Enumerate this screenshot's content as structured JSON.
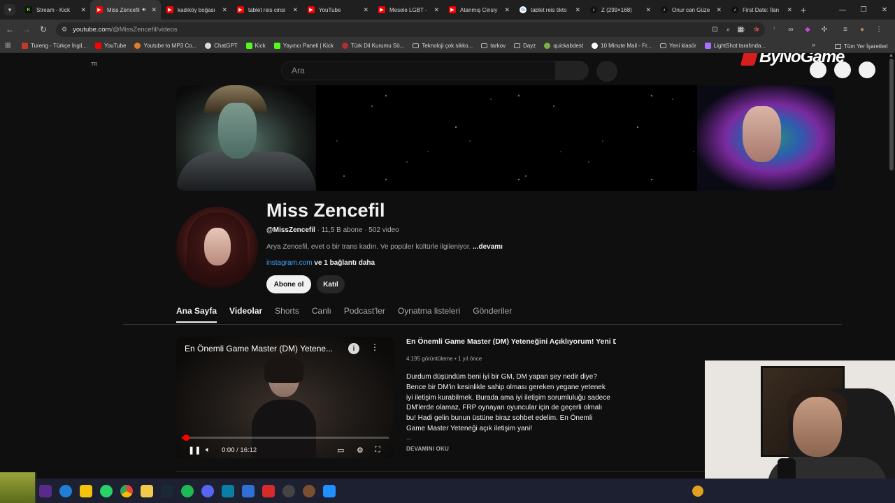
{
  "browser": {
    "tabs": [
      {
        "label": "Stream - Kick",
        "icon": "kick-icon",
        "kind": "kick",
        "active": false
      },
      {
        "label": "Miss Zencefil",
        "icon": "youtube-icon",
        "kind": "yt",
        "active": true
      },
      {
        "label": "kadıköy boğası",
        "icon": "youtube-icon",
        "kind": "yt",
        "active": false
      },
      {
        "label": "tablet reis cinsi",
        "icon": "youtube-icon",
        "kind": "yt",
        "active": false
      },
      {
        "label": "YouTube",
        "icon": "youtube-icon",
        "kind": "yt",
        "active": false
      },
      {
        "label": "Mesele LGBT -",
        "icon": "youtube-icon",
        "kind": "yt",
        "active": false
      },
      {
        "label": "Atanmış Cinsiy",
        "icon": "youtube-icon",
        "kind": "yt",
        "active": false
      },
      {
        "label": "tablet reis tikto",
        "icon": "google-icon",
        "kind": "g",
        "active": false
      },
      {
        "label": "Z (299×168)",
        "icon": "tiktok-icon",
        "kind": "tk",
        "active": false
      },
      {
        "label": "Onur can Güze",
        "icon": "tiktok-icon",
        "kind": "tk",
        "active": false
      },
      {
        "label": "First Date: İlan",
        "icon": "tiktok-icon",
        "kind": "tk",
        "active": false
      }
    ],
    "url_domain": "youtube.com",
    "url_path": "/@MissZencefil/videos",
    "bookmarks": [
      {
        "label": "Tureng - Türkçe İngil...",
        "icon": "tureng-icon"
      },
      {
        "label": "YouTube",
        "icon": "youtube-icon"
      },
      {
        "label": "Youtube to MP3 Co...",
        "icon": "converter-icon"
      },
      {
        "label": "ChatGPT",
        "icon": "chatgpt-icon"
      },
      {
        "label": "Kick",
        "icon": "kick-icon"
      },
      {
        "label": "Yayıncı Paneli | Kick",
        "icon": "kick-icon"
      },
      {
        "label": "Türk Dil Kurumu Sö...",
        "icon": "tdk-icon"
      },
      {
        "label": "Teknoloji çok sikko...",
        "icon": "folder-icon"
      },
      {
        "label": "tarkov",
        "icon": "folder-icon"
      },
      {
        "label": "Dayz",
        "icon": "folder-icon"
      },
      {
        "label": "quickabdest",
        "icon": "frog-icon"
      },
      {
        "label": "10 Minute Mail - Fr...",
        "icon": "mail-icon"
      },
      {
        "label": "Yeni klasör",
        "icon": "folder-icon"
      },
      {
        "label": "LightShot tarafında...",
        "icon": "lightshot-icon"
      }
    ],
    "bookmarks_all": "Tüm Yer İşaretleri"
  },
  "youtube": {
    "locale": "TR",
    "search_placeholder": "Ara",
    "overlay_logo": "ByNoGame",
    "channel": {
      "name": "Miss Zencefil",
      "handle": "@MissZencefil",
      "stats": " · 11,5 B abone · 502 video",
      "description": "Arya Zencefil, evet o bir trans kadın. Ve popüler kültürle ilgileniyor. ",
      "description_more": "...devamı",
      "link": "instagram.com",
      "link_extra": " ve 1 bağlantı daha",
      "subscribe": "Abone ol",
      "join": "Katıl"
    },
    "tabs": [
      {
        "label": "Ana Sayfa",
        "name": "tab-home"
      },
      {
        "label": "Videolar",
        "name": "tab-videos"
      },
      {
        "label": "Shorts",
        "name": "tab-shorts"
      },
      {
        "label": "Canlı",
        "name": "tab-live"
      },
      {
        "label": "Podcast'ler",
        "name": "tab-podcasts"
      },
      {
        "label": "Oynatma listeleri",
        "name": "tab-playlists"
      },
      {
        "label": "Gönderiler",
        "name": "tab-posts"
      }
    ],
    "featured": {
      "overlay_title": "En Önemli Game Master (DM) Yetene...",
      "title": "En Önemli Game Master (DM) Yeteneğini Açıklıyorum! Yeni D...",
      "meta": "4.195 görüntüleme • 1 yıl önce",
      "description": "Durdum düşündüm beni iyi bir GM, DM yapan şey nedir diye? Bence bir DM'in kesinlikle sahip olması gereken yegane yetenek iyi iletişim kurabilmek. Burada ama iyi iletişim sorumluluğu sadece DM'lerde olamaz, FRP oynayan oyuncular için de geçerli olmalı bu! Hadi gelin bunun üstüne biraz sohbet edelim. En Önemli Game Master Yeteneği açık iletişim yani!",
      "ellipsis": "...",
      "read_more": "DEVAMINI OKU",
      "current_time": "0:00",
      "duration": " / 16:12",
      "progress": 0.02
    }
  }
}
